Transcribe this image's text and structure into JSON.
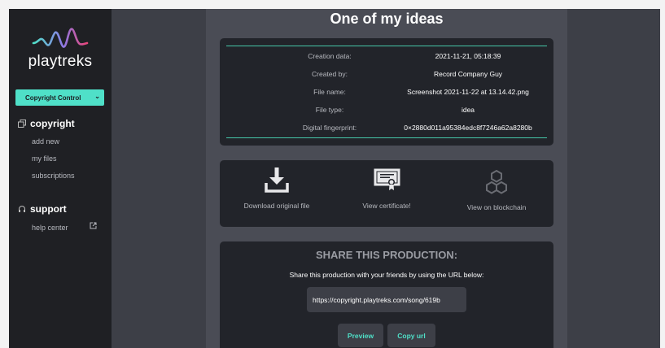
{
  "sidebar": {
    "brand": "playtreks",
    "dropdown": {
      "value": "Copyright Control"
    },
    "sections": [
      {
        "title": "copyright",
        "items": [
          "add new",
          "my files",
          "subscriptions"
        ]
      },
      {
        "title": "support",
        "items": [
          "help center"
        ]
      }
    ]
  },
  "page": {
    "title": "One of my ideas"
  },
  "info": {
    "rows": [
      {
        "label": "Creation data:",
        "value": "2021-11-21, 05:18:39"
      },
      {
        "label": "Created by:",
        "value": "Record Company Guy"
      },
      {
        "label": "File name:",
        "value": "Screenshot 2021-11-22 at 13.14.42.png"
      },
      {
        "label": "File type:",
        "value": "idea"
      },
      {
        "label": "Digital fingerprint:",
        "value": "0×2880d011a95384edc8f7246a62a8280b"
      }
    ]
  },
  "actions": {
    "download": "Download original file",
    "certificate": "View certificate!",
    "blockchain": "View on blockchain"
  },
  "share": {
    "title": "SHARE THIS PRODUCTION:",
    "text": "Share this production with your friends by using the URL below:",
    "url": "https://copyright.playtreks.com/song/619b",
    "preview": "Preview",
    "copy": "Copy url"
  },
  "colors": {
    "accent": "#4fe0c8",
    "sidebar": "#1f2024",
    "card": "#22242a",
    "background": "#3d3f47"
  },
  "icons": [
    "playtreks-wave-logo",
    "chevron-down-icon",
    "copyright-files-icon",
    "headset-icon",
    "external-link-icon",
    "download-icon",
    "certificate-icon",
    "blockchain-icon"
  ]
}
